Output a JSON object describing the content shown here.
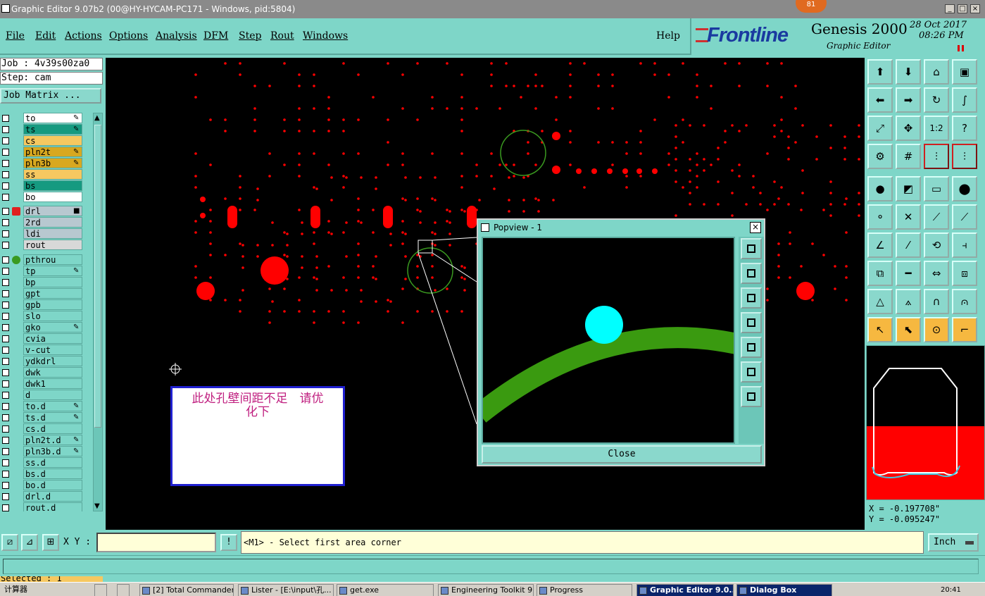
{
  "window": {
    "title": "Graphic Editor 9.07b2 (00@HY-HYCAM-PC171 - Windows, pid:5804)",
    "badge": "81",
    "min_label": "_",
    "max_label": "□",
    "close_label": "×"
  },
  "menu": {
    "items": [
      "File",
      "Edit",
      "Actions",
      "Options",
      "Analysis",
      "DFM",
      "Step",
      "Rout",
      "Windows"
    ],
    "help": "Help"
  },
  "brand": {
    "logo": "Frontline",
    "product": "Genesis 2000",
    "subtitle": "Graphic Editor",
    "date": "28 Oct 2017",
    "time": "08:26 PM"
  },
  "left": {
    "job": "Job : 4v39s00za0",
    "step": "Step: cam",
    "job_matrix": "Job Matrix ...",
    "selected": "Selected : 1",
    "layers": [
      {
        "name": "to",
        "color": "#ffffff",
        "mark": "✎"
      },
      {
        "name": "ts",
        "color": "#159a80",
        "mark": "✎"
      },
      {
        "name": "cs",
        "color": "#f6c860",
        "mark": ""
      },
      {
        "name": "pln2t",
        "color": "#d8a820",
        "mark": "✎"
      },
      {
        "name": "pln3b",
        "color": "#d8a820",
        "mark": "✎"
      },
      {
        "name": "ss",
        "color": "#f6c860",
        "mark": ""
      },
      {
        "name": "bs",
        "color": "#159a80",
        "mark": ""
      },
      {
        "name": "bo",
        "color": "#ffffff",
        "mark": ""
      },
      {
        "name": "drl",
        "color": "#b8c8d0",
        "mark": "■",
        "indicator": "arrow"
      },
      {
        "name": "2rd",
        "color": "#b8c8d0",
        "mark": ""
      },
      {
        "name": "ldi",
        "color": "#b8c8d0",
        "mark": ""
      },
      {
        "name": "rout",
        "color": "#d8d8d8",
        "mark": ""
      },
      {
        "name": "pthrou",
        "color": "#7ed6c8",
        "mark": "",
        "indicator": "green-dot"
      },
      {
        "name": "tp",
        "color": "#7ed6c8",
        "mark": "✎"
      },
      {
        "name": "bp",
        "color": "#7ed6c8",
        "mark": ""
      },
      {
        "name": "gpt",
        "color": "#7ed6c8",
        "mark": ""
      },
      {
        "name": "gpb",
        "color": "#7ed6c8",
        "mark": ""
      },
      {
        "name": "slo",
        "color": "#7ed6c8",
        "mark": ""
      },
      {
        "name": "gko",
        "color": "#7ed6c8",
        "mark": "✎"
      },
      {
        "name": "cvia",
        "color": "#7ed6c8",
        "mark": ""
      },
      {
        "name": "v-cut",
        "color": "#7ed6c8",
        "mark": ""
      },
      {
        "name": "ydkdrl",
        "color": "#7ed6c8",
        "mark": ""
      },
      {
        "name": "dwk",
        "color": "#7ed6c8",
        "mark": ""
      },
      {
        "name": "dwk1",
        "color": "#7ed6c8",
        "mark": ""
      },
      {
        "name": "d",
        "color": "#7ed6c8",
        "mark": ""
      },
      {
        "name": "to.d",
        "color": "#7ed6c8",
        "mark": "✎"
      },
      {
        "name": "ts.d",
        "color": "#7ed6c8",
        "mark": "✎"
      },
      {
        "name": "cs.d",
        "color": "#7ed6c8",
        "mark": ""
      },
      {
        "name": "pln2t.d",
        "color": "#7ed6c8",
        "mark": "✎"
      },
      {
        "name": "pln3b.d",
        "color": "#7ed6c8",
        "mark": "✎"
      },
      {
        "name": "ss.d",
        "color": "#7ed6c8",
        "mark": ""
      },
      {
        "name": "bs.d",
        "color": "#7ed6c8",
        "mark": ""
      },
      {
        "name": "bo.d",
        "color": "#7ed6c8",
        "mark": ""
      },
      {
        "name": "drl.d",
        "color": "#7ed6c8",
        "mark": ""
      },
      {
        "name": "rout.d",
        "color": "#7ed6c8",
        "mark": ""
      }
    ]
  },
  "note": {
    "line1": "此处孔壁间距不足　请优",
    "line2": "化下"
  },
  "popview": {
    "title": "Popview - 1",
    "close_label": "Close",
    "close_x": "×",
    "tools": [
      "zoom-window-icon",
      "pan-up-icon",
      "pan-down-icon",
      "pan-left-icon",
      "pan-right-icon",
      "zoom-fit-icon",
      "zoom-center-icon"
    ]
  },
  "right_tools": {
    "buttons": [
      {
        "name": "pan-up-tool-icon",
        "glyph": "⬆"
      },
      {
        "name": "pan-down-tool-icon",
        "glyph": "⬇"
      },
      {
        "name": "home-tool-icon",
        "glyph": "⌂"
      },
      {
        "name": "zoom-box-tool-icon",
        "glyph": "▣"
      },
      {
        "name": "pan-left-tool-icon",
        "glyph": "⬅"
      },
      {
        "name": "pan-right-tool-icon",
        "glyph": "➡"
      },
      {
        "name": "redraw-tool-icon",
        "glyph": "↻"
      },
      {
        "name": "snap-tool-icon",
        "glyph": "∫"
      },
      {
        "name": "zoom-fit-tool-icon",
        "glyph": "⤢"
      },
      {
        "name": "zoom-center-tool-icon",
        "glyph": "✥"
      },
      {
        "name": "scale-1-2-tool-icon",
        "glyph": "1:2"
      },
      {
        "name": "help-tool-icon",
        "glyph": "?"
      },
      {
        "name": "settings-tool-icon",
        "glyph": "⚙"
      },
      {
        "name": "grid-tool-icon",
        "glyph": "#"
      },
      {
        "name": "connect-tool-icon",
        "glyph": "⫶",
        "red": true
      },
      {
        "name": "connect2-tool-icon",
        "glyph": "⫶",
        "red": true
      },
      {
        "name": "pad-add-tool-icon",
        "glyph": "●"
      },
      {
        "name": "fill-tool-icon",
        "glyph": "◩"
      },
      {
        "name": "ruler-tool-icon",
        "glyph": "▭"
      },
      {
        "name": "dot-tool-icon",
        "glyph": "⬤"
      },
      {
        "name": "node-tool-icon",
        "glyph": "⚬"
      },
      {
        "name": "cross-tool-icon",
        "glyph": "✕"
      },
      {
        "name": "line-point-tool-icon",
        "glyph": "⟋"
      },
      {
        "name": "line-point2-tool-icon",
        "glyph": "⟋"
      },
      {
        "name": "angle-tool-icon",
        "glyph": "∠"
      },
      {
        "name": "slash-tool-icon",
        "glyph": "⁄"
      },
      {
        "name": "arc-tool-icon",
        "glyph": "⟲"
      },
      {
        "name": "mirror-tool-icon",
        "glyph": "⫞"
      },
      {
        "name": "pad-move-tool-icon",
        "glyph": "⧉"
      },
      {
        "name": "line-tool-icon",
        "glyph": "━"
      },
      {
        "name": "measure-tool-icon",
        "glyph": "⇔"
      },
      {
        "name": "copy-tool-icon",
        "glyph": "⧈"
      },
      {
        "name": "triangle-tool-icon",
        "glyph": "△"
      },
      {
        "name": "triangle2-tool-icon",
        "glyph": "⟑"
      },
      {
        "name": "arch-tool-icon",
        "glyph": "∩"
      },
      {
        "name": "arch2-tool-icon",
        "glyph": "⩀"
      },
      {
        "name": "pointer-tool-icon",
        "glyph": "↖",
        "sel": true
      },
      {
        "name": "pointer-box-tool-icon",
        "glyph": "⬉",
        "sel": true
      },
      {
        "name": "pointer-circle-tool-icon",
        "glyph": "⊙",
        "sel": true
      },
      {
        "name": "route-tool-icon",
        "glyph": "⌐",
        "sel": true
      }
    ]
  },
  "coords": {
    "x": "X = -0.197708\"",
    "y": "Y = -0.095247\""
  },
  "command": {
    "xy_label": "X Y :",
    "xy_value": "",
    "prompt": "<M1> - Select first area corner",
    "units": "Inch",
    "exclaim": "!"
  },
  "taskbar": {
    "start": "计算器",
    "tasks": [
      {
        "label": "[2] Total Commander...",
        "active": false
      },
      {
        "label": "Lister - [E:\\input\\孔...",
        "active": false
      },
      {
        "label": "get.exe",
        "active": false
      },
      {
        "label": "Engineering Toolkit 9...",
        "active": false
      },
      {
        "label": "Progress",
        "active": false
      },
      {
        "label": "Graphic Editor 9.0...",
        "active": true
      },
      {
        "label": "Dialog Box",
        "active": true
      }
    ],
    "clock": "20:41"
  },
  "colors": {
    "accent": "#7ed6c8",
    "pad": "#ff0000",
    "ring": "#3a9a20",
    "highlight": "#00ffff",
    "note_border": "#2020d0",
    "note_text": "#c02080"
  }
}
